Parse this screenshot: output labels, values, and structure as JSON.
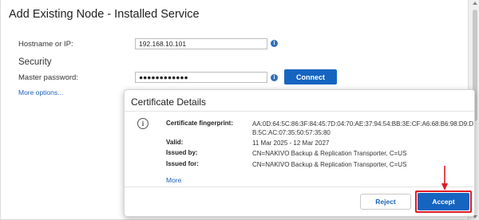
{
  "panel": {
    "title": "Add Existing Node - Installed Service",
    "hostname_label": "Hostname or IP:",
    "hostname_value": "192.168.10.101",
    "security_label": "Security",
    "password_label": "Master password:",
    "password_value": "●●●●●●●●●●●●",
    "connect_label": "Connect",
    "more_options_label": "More options..."
  },
  "modal": {
    "title": "Certificate Details",
    "fingerprint_label": "Certificate fingerprint:",
    "fingerprint_value": "AA:0D:64:5C:86:3F:84:45:7D:04:70:AE:37:94:54:BB:3E:CF:A6:68:B6:98:D9:DB:5C:AC:07:35:50:57:35:80",
    "valid_label": "Valid:",
    "valid_value": "11 Mar 2025 - 12 Mar 2027",
    "issued_by_label": "Issued by:",
    "issued_by_value": "CN=NAKIVO Backup & Replication Transporter, C=US",
    "issued_for_label": "Issued for:",
    "issued_for_value": "CN=NAKIVO Backup & Replication Transporter, C=US",
    "more_label": "More",
    "reject_label": "Reject",
    "accept_label": "Accept"
  },
  "icons": {
    "info": "i",
    "modal_info": "i"
  },
  "colors": {
    "primary": "#1565c0",
    "link": "#1e63b6",
    "highlight": "#e01b24"
  }
}
